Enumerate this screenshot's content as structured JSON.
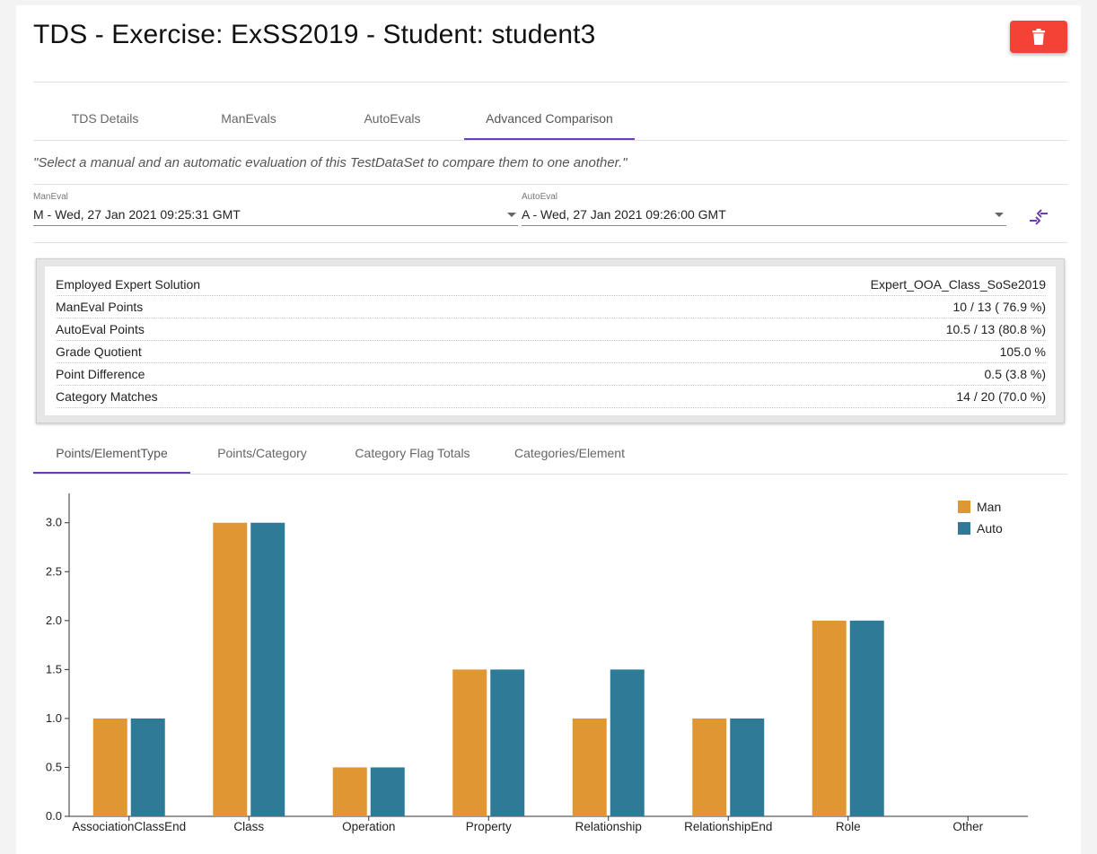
{
  "page": {
    "title": "TDS - Exercise: ExSS2019 - Student: student3"
  },
  "tabs": [
    {
      "label": "TDS Details",
      "active": false
    },
    {
      "label": "ManEvals",
      "active": false
    },
    {
      "label": "AutoEvals",
      "active": false
    },
    {
      "label": "Advanced Comparison",
      "active": true
    }
  ],
  "instruction": "\"Select a manual and an automatic evaluation of this TestDataSet to compare them to one another.\"",
  "selectors": {
    "maneval": {
      "label": "ManEval",
      "value": "M - Wed, 27 Jan 2021 09:25:31 GMT"
    },
    "autoeval": {
      "label": "AutoEval",
      "value": "A - Wed, 27 Jan 2021 09:26:00 GMT"
    },
    "swap_icon": "compare-arrows-icon"
  },
  "stats": [
    {
      "label": "Employed Expert Solution",
      "value": "Expert_OOA_Class_SoSe2019"
    },
    {
      "label": "ManEval Points",
      "value": "10 / 13 ( 76.9 %)"
    },
    {
      "label": "AutoEval Points",
      "value": "10.5 / 13 (80.8 %)"
    },
    {
      "label": "Grade Quotient",
      "value": "105.0 %"
    },
    {
      "label": "Point Difference",
      "value": "0.5 (3.8 %)"
    },
    {
      "label": "Category Matches",
      "value": "14 / 20 (70.0 %)"
    }
  ],
  "chart_tabs": [
    {
      "label": "Points/ElementType",
      "active": true
    },
    {
      "label": "Points/Category",
      "active": false
    },
    {
      "label": "Category Flag Totals",
      "active": false
    },
    {
      "label": "Categories/Element",
      "active": false
    }
  ],
  "colors": {
    "accent": "#6a3fb5",
    "delete": "#f44336",
    "man": "#e09733",
    "auto": "#2e7b97"
  },
  "chart_data": {
    "type": "bar",
    "categories": [
      "AssociationClassEnd",
      "Class",
      "Operation",
      "Property",
      "Relationship",
      "RelationshipEnd",
      "Role",
      "Other"
    ],
    "series": [
      {
        "name": "Man",
        "color": "#e09733",
        "values": [
          1,
          3,
          0.5,
          1.5,
          1,
          1,
          2,
          0
        ]
      },
      {
        "name": "Auto",
        "color": "#2e7b97",
        "values": [
          1,
          3,
          0.5,
          1.5,
          1.5,
          1,
          2,
          0
        ]
      }
    ],
    "ylim": [
      0,
      3.3
    ],
    "yticks": [
      "0.0",
      "0.5",
      "1.0",
      "1.5",
      "2.0",
      "2.5",
      "3.0"
    ],
    "grid": false,
    "legend": "top-right"
  }
}
